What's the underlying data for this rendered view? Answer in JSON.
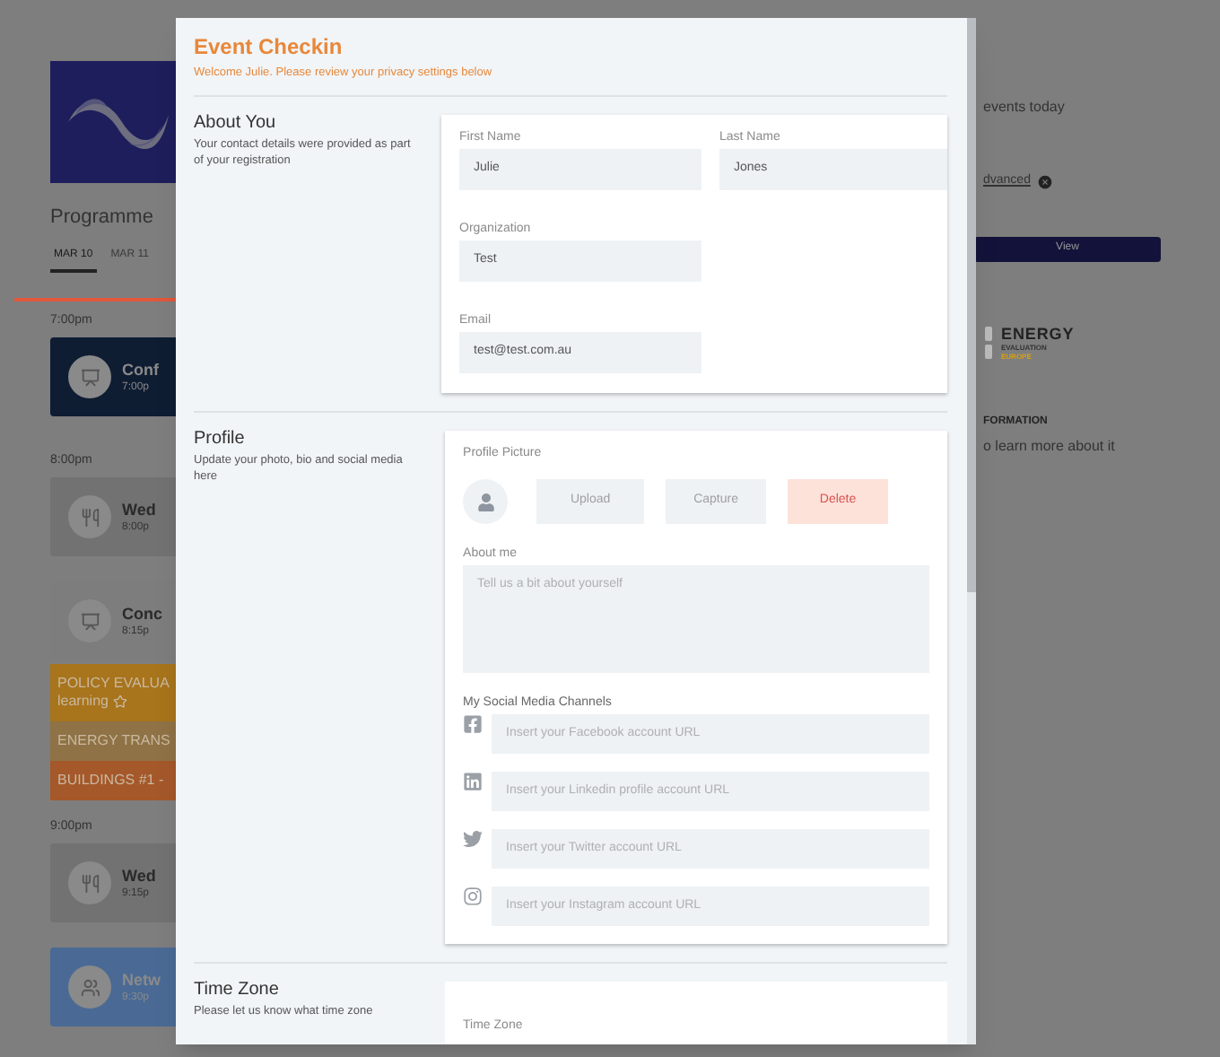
{
  "background": {
    "programme_title": "Programme",
    "date_tabs": [
      {
        "label": "MAR 10",
        "selected": true
      },
      {
        "label": "MAR 11",
        "selected": false
      }
    ],
    "schedule": [
      {
        "kind": "time",
        "label": "7:00pm"
      },
      {
        "kind": "session",
        "title": "Conf",
        "time": "7:00p",
        "color": "#0f1d33"
      },
      {
        "kind": "time",
        "label": "8:00pm"
      },
      {
        "kind": "session",
        "title": "Wed",
        "time": "8:00p",
        "color": "#727272"
      },
      {
        "kind": "session",
        "title": "Conc",
        "time": "8:15p",
        "color": "#7d7d7d"
      },
      {
        "kind": "track",
        "title": "POLICY EVALUA",
        "subtitle": "learning",
        "favorite": false,
        "color": "#a8741c"
      },
      {
        "kind": "track",
        "title": "ENERGY TRANS",
        "color": "#8f7245"
      },
      {
        "kind": "track",
        "title": "BUILDINGS #1 -",
        "color": "#a5582a"
      },
      {
        "kind": "time",
        "label": "9:00pm"
      },
      {
        "kind": "session",
        "title": "Wed",
        "time": "9:15p",
        "color": "#727272"
      },
      {
        "kind": "session",
        "title": "Netw",
        "time": "9:30p",
        "color": "#4a6a95"
      }
    ],
    "events_text": "events today",
    "filter_link": "dvanced",
    "view_button": "View",
    "logo": {
      "name": "ENERGY",
      "line2": "EVALUATION",
      "line3": "EUROPE"
    },
    "info_heading": "FORMATION",
    "info_text": "o learn more about it"
  },
  "modal": {
    "title": "Event Checkin",
    "subtitle": "Welcome Julie. Please review your privacy settings below",
    "sections": [
      {
        "kind": "about",
        "heading": "About You",
        "description": "Your contact details were provided as part of your registration",
        "fields": [
          {
            "label": "First Name",
            "value": "Julie"
          },
          {
            "label": "Last Name",
            "value": "Jones"
          },
          {
            "label": "Organization",
            "value": "Test"
          },
          {
            "label": "Email",
            "value": "test@test.com.au"
          }
        ]
      },
      {
        "kind": "profile",
        "heading": "Profile",
        "description": "Update your photo, bio and social media here",
        "picture_label": "Profile Picture",
        "buttons": [
          {
            "label": "Upload",
            "kind": "plain"
          },
          {
            "label": "Capture",
            "kind": "plain"
          },
          {
            "label": "Delete",
            "kind": "danger"
          }
        ],
        "about_label": "About me",
        "about_placeholder": "Tell us a bit about yourself",
        "social_label": "My Social Media Channels",
        "social": [
          {
            "kind": "facebook",
            "placeholder": "Insert your Facebook account URL"
          },
          {
            "kind": "linkedin",
            "placeholder": "Insert your Linkedin profile account URL"
          },
          {
            "kind": "twitter",
            "placeholder": "Insert your Twitter account URL"
          },
          {
            "kind": "instagram",
            "placeholder": "Insert your Instagram account URL"
          }
        ]
      },
      {
        "kind": "timezone",
        "heading": "Time Zone",
        "description": "Please let us know what time zone",
        "field_label": "Time Zone"
      }
    ]
  }
}
